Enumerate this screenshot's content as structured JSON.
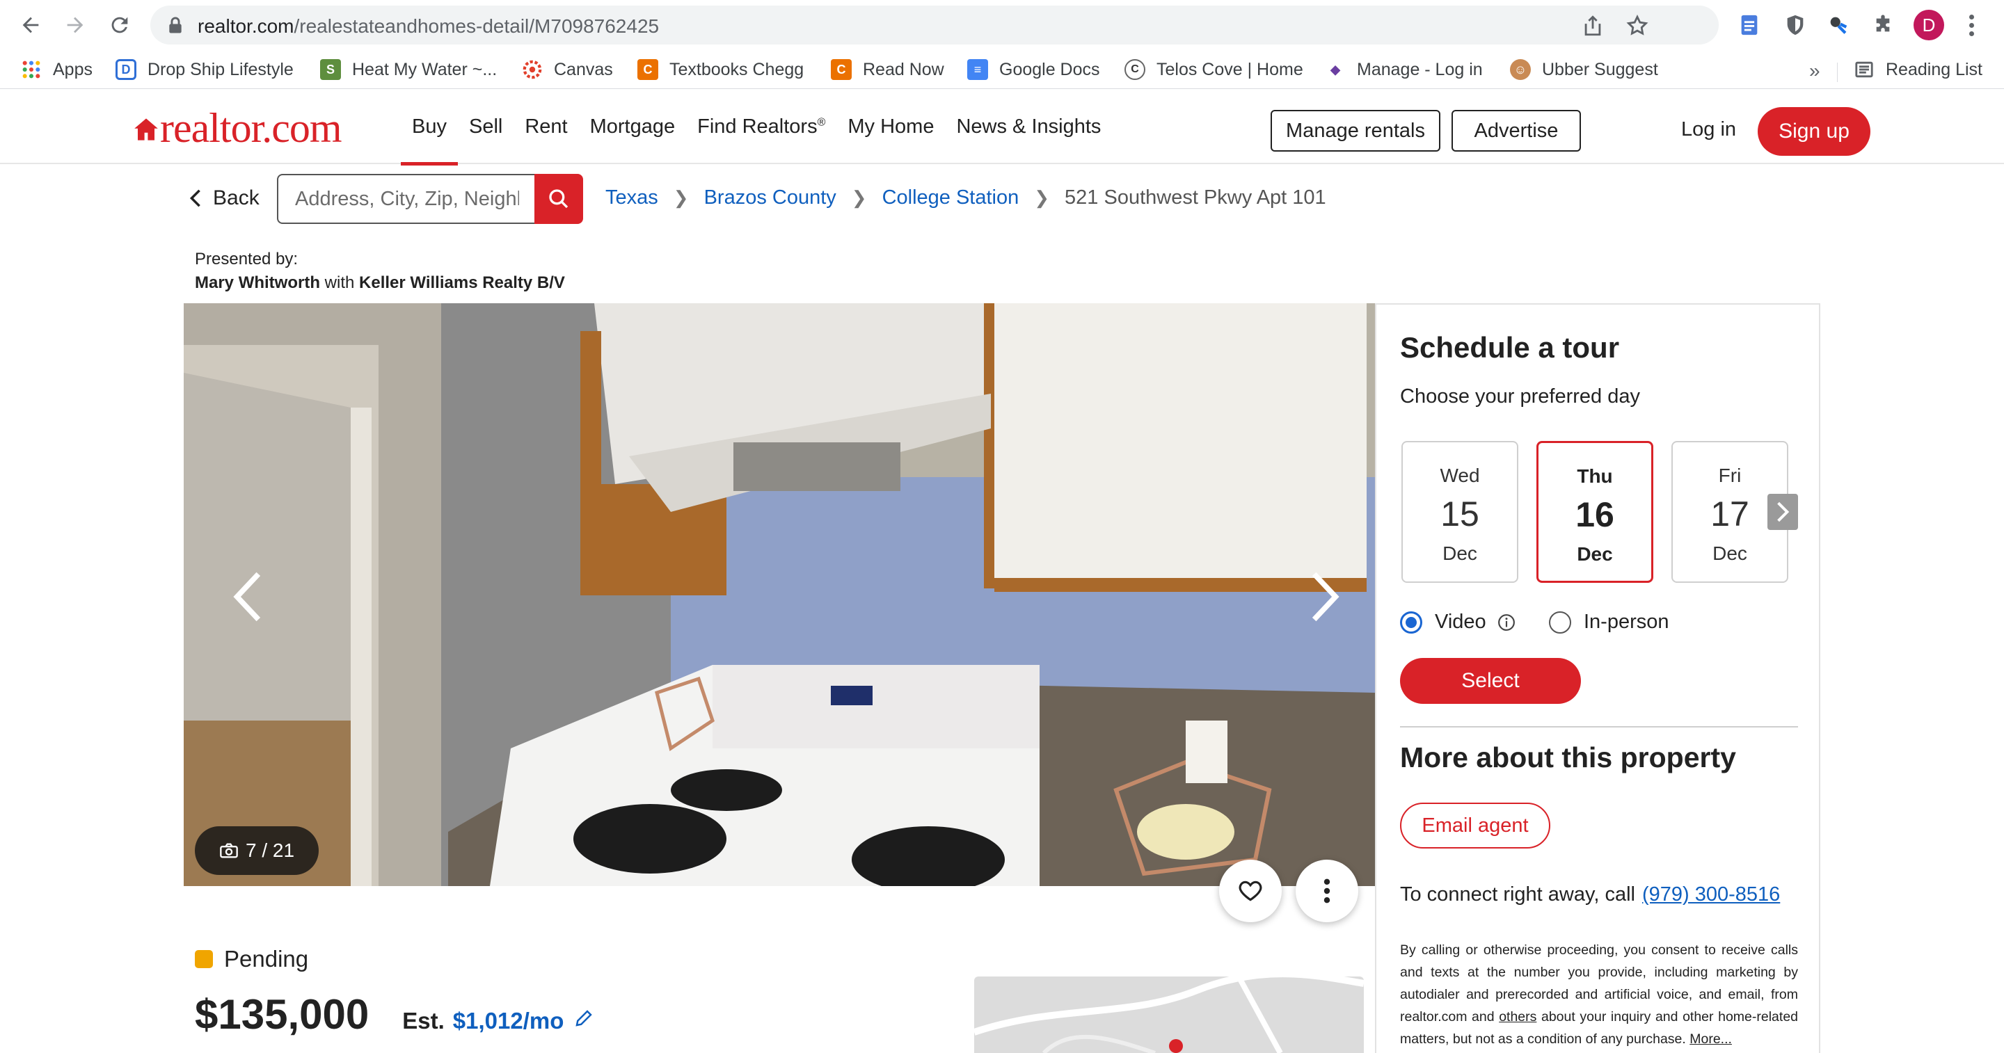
{
  "browser": {
    "url_host": "realtor.com",
    "url_path": "/realestateandhomes-detail/M7098762425",
    "profile_initial": "D",
    "bookmarks": [
      {
        "label": "Apps",
        "icon": "apps-grid-icon"
      },
      {
        "label": "Drop Ship Lifestyle",
        "icon": "dropship-icon"
      },
      {
        "label": "Heat My Water ~...",
        "icon": "shopify-icon"
      },
      {
        "label": "Canvas",
        "icon": "canvas-icon"
      },
      {
        "label": "Textbooks Chegg",
        "icon": "chegg-icon"
      },
      {
        "label": "Read Now",
        "icon": "chegg-icon"
      },
      {
        "label": "Google Docs",
        "icon": "google-docs-icon"
      },
      {
        "label": "Telos Cove | Home",
        "icon": "telos-icon"
      },
      {
        "label": "Manage - Log in",
        "icon": "manage-icon"
      },
      {
        "label": "Ubber Suggest",
        "icon": "ubersuggest-icon"
      }
    ],
    "overflow": "»",
    "reading_list": "Reading List"
  },
  "header": {
    "logo": "realtor.com",
    "nav": [
      "Buy",
      "Sell",
      "Rent",
      "Mortgage",
      "Find Realtors",
      "My Home",
      "News & Insights"
    ],
    "nav_reg": "®",
    "manage_rentals": "Manage rentals",
    "advertise": "Advertise",
    "login": "Log in",
    "signup": "Sign up",
    "brand_color": "#d92228"
  },
  "search": {
    "back": "Back",
    "placeholder": "Address, City, Zip, Neighborhood",
    "breadcrumbs": [
      "Texas",
      "Brazos County",
      "College Station"
    ],
    "current": "521 Southwest Pkwy Apt 101"
  },
  "presented": {
    "label": "Presented by:",
    "agent": "Mary Whitworth",
    "with": "with",
    "brokerage": "Keller Williams Realty B/V"
  },
  "gallery": {
    "counter": "7 / 21"
  },
  "tour": {
    "title": "Schedule a tour",
    "subtitle": "Choose your preferred day",
    "days": [
      {
        "dow": "Wed",
        "day": "15",
        "mon": "Dec"
      },
      {
        "dow": "Thu",
        "day": "16",
        "mon": "Dec"
      },
      {
        "dow": "Fri",
        "day": "17",
        "mon": "Dec"
      }
    ],
    "video": "Video",
    "in_person": "In-person",
    "select": "Select"
  },
  "more": {
    "title": "More about this property",
    "email_agent": "Email agent",
    "connect": "To connect right away, call",
    "phone": "(979) 300-8516",
    "legal_1": "By calling or otherwise proceeding, you consent to receive calls and texts at the number you provide, including marketing by autodialer and prerecorded and artificial voice, and email, from realtor.com and",
    "legal_others": "others",
    "legal_2": "about your inquiry and other home-related matters, but not as a condition of any purchase.",
    "legal_more": "More..."
  },
  "listing": {
    "status": "Pending",
    "price": "$135,000",
    "est_label": "Est.",
    "est_value": "$1,012/mo"
  }
}
